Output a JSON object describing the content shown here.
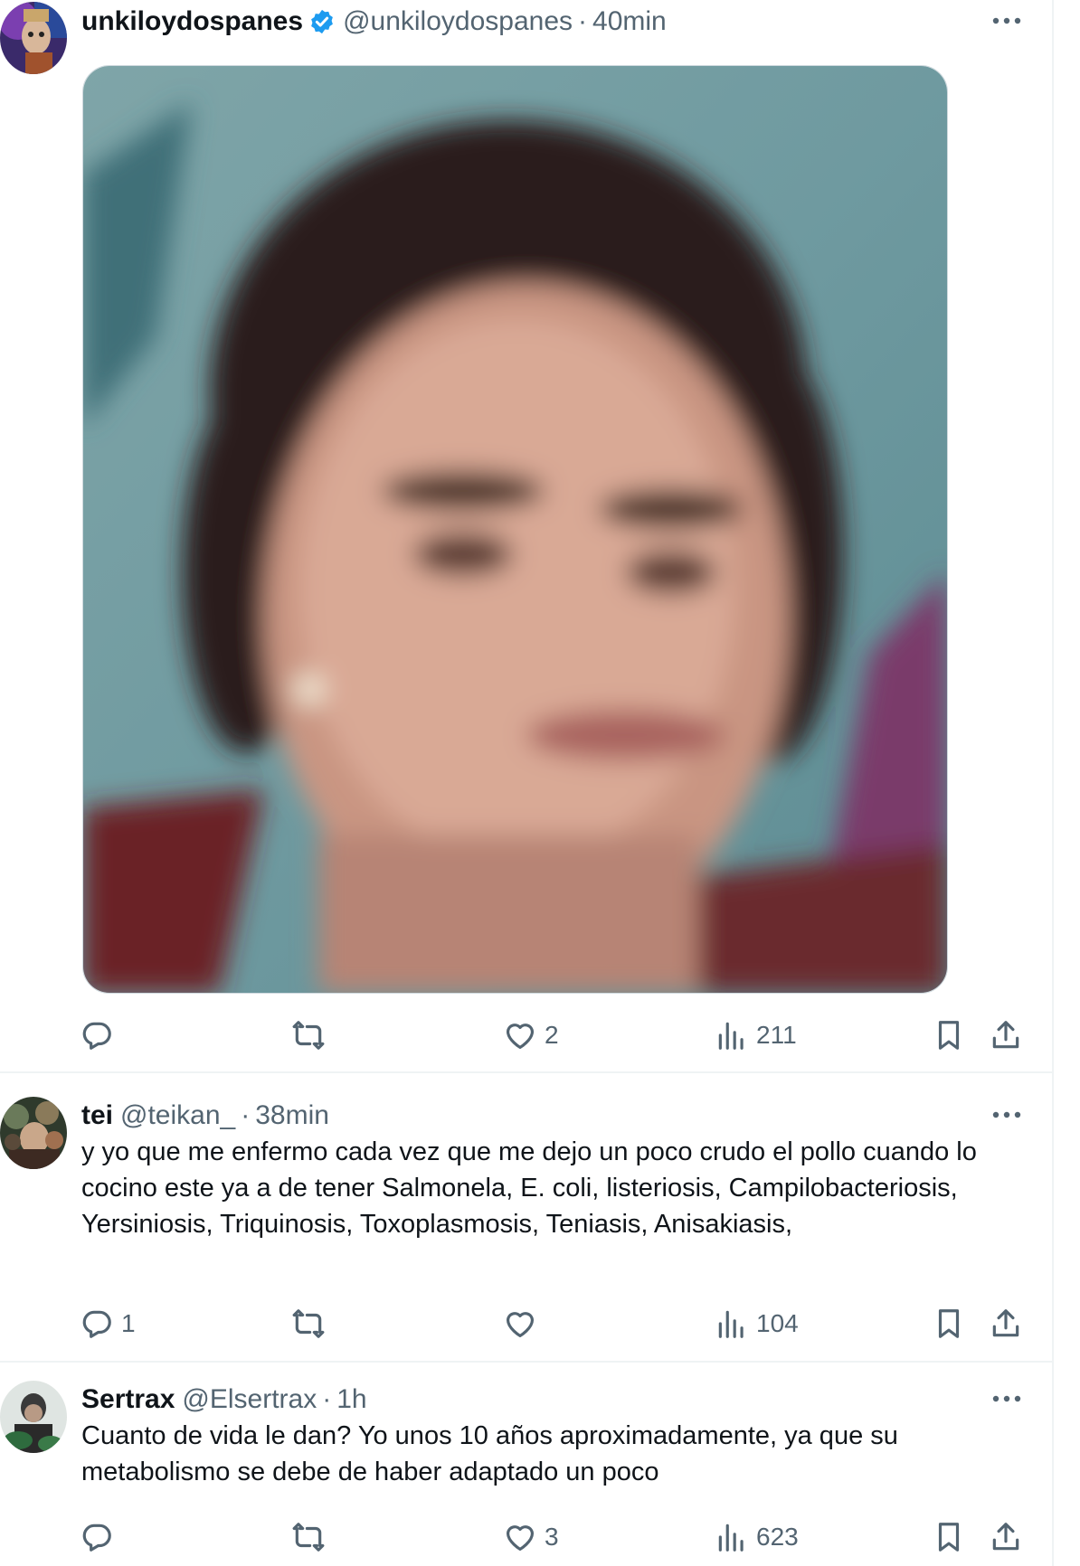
{
  "tweets": [
    {
      "name": "unkiloydospanes",
      "handle": "@unkiloydospanes",
      "time": "40min",
      "verified": true,
      "text": "",
      "stats": {
        "replies": "",
        "retweets": "",
        "likes": "2",
        "views": "211"
      }
    },
    {
      "name": "tei",
      "handle": "@teikan_",
      "time": "38min",
      "text": "y yo que me enfermo cada vez que me dejo un poco crudo el pollo cuando lo cocino este ya a de tener Salmonela, E. coli, listeriosis, Campilobacteriosis, Yersiniosis, Triquinosis, Toxoplasmosis, Teniasis, Anisakiasis,",
      "stats": {
        "replies": "1",
        "retweets": "",
        "likes": "",
        "views": "104"
      }
    },
    {
      "name": "Sertrax",
      "handle": "@Elsertrax",
      "time": "1h",
      "text": "Cuanto de vida le dan? Yo unos 10 años aproximadamente, ya que su metabolismo se debe de haber adaptado un poco",
      "stats": {
        "replies": "",
        "retweets": "",
        "likes": "3",
        "views": "623"
      }
    }
  ],
  "separator": "·",
  "colors": {
    "text": "#0f1419",
    "secondary": "#536471",
    "verified": "#1d9bf0",
    "border": "#eff3f4"
  },
  "icons": [
    "verified-badge-icon",
    "more-icon",
    "reply-icon",
    "retweet-icon",
    "like-icon",
    "views-icon",
    "bookmark-icon",
    "share-icon"
  ]
}
